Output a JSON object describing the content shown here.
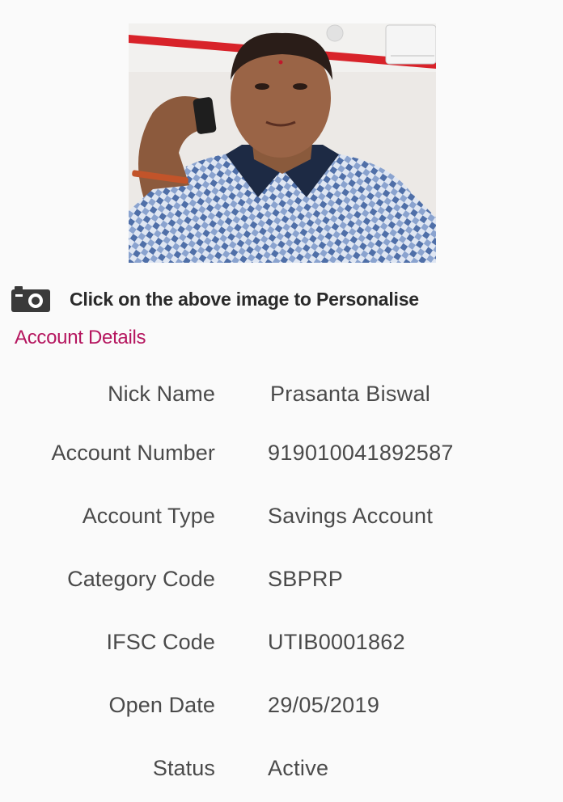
{
  "profile": {
    "photo_icon": "profile-photo",
    "camera_icon": "camera-icon",
    "hint": "Click on the above image to Personalise"
  },
  "account_details": {
    "title": "Account Details",
    "rows": [
      {
        "label": "Nick Name",
        "value": "Prasanta Biswal"
      },
      {
        "label": "Account Number",
        "value": "919010041892587"
      },
      {
        "label": "Account Type",
        "value": "Savings Account"
      },
      {
        "label": "Category Code",
        "value": "SBPRP"
      },
      {
        "label": "IFSC Code",
        "value": "UTIB0001862"
      },
      {
        "label": "Open Date",
        "value": "29/05/2019"
      },
      {
        "label": "Status",
        "value": "Active"
      }
    ]
  },
  "colors": {
    "accent": "#b5165f",
    "text": "#4a4a4a",
    "background": "#fafafa"
  }
}
